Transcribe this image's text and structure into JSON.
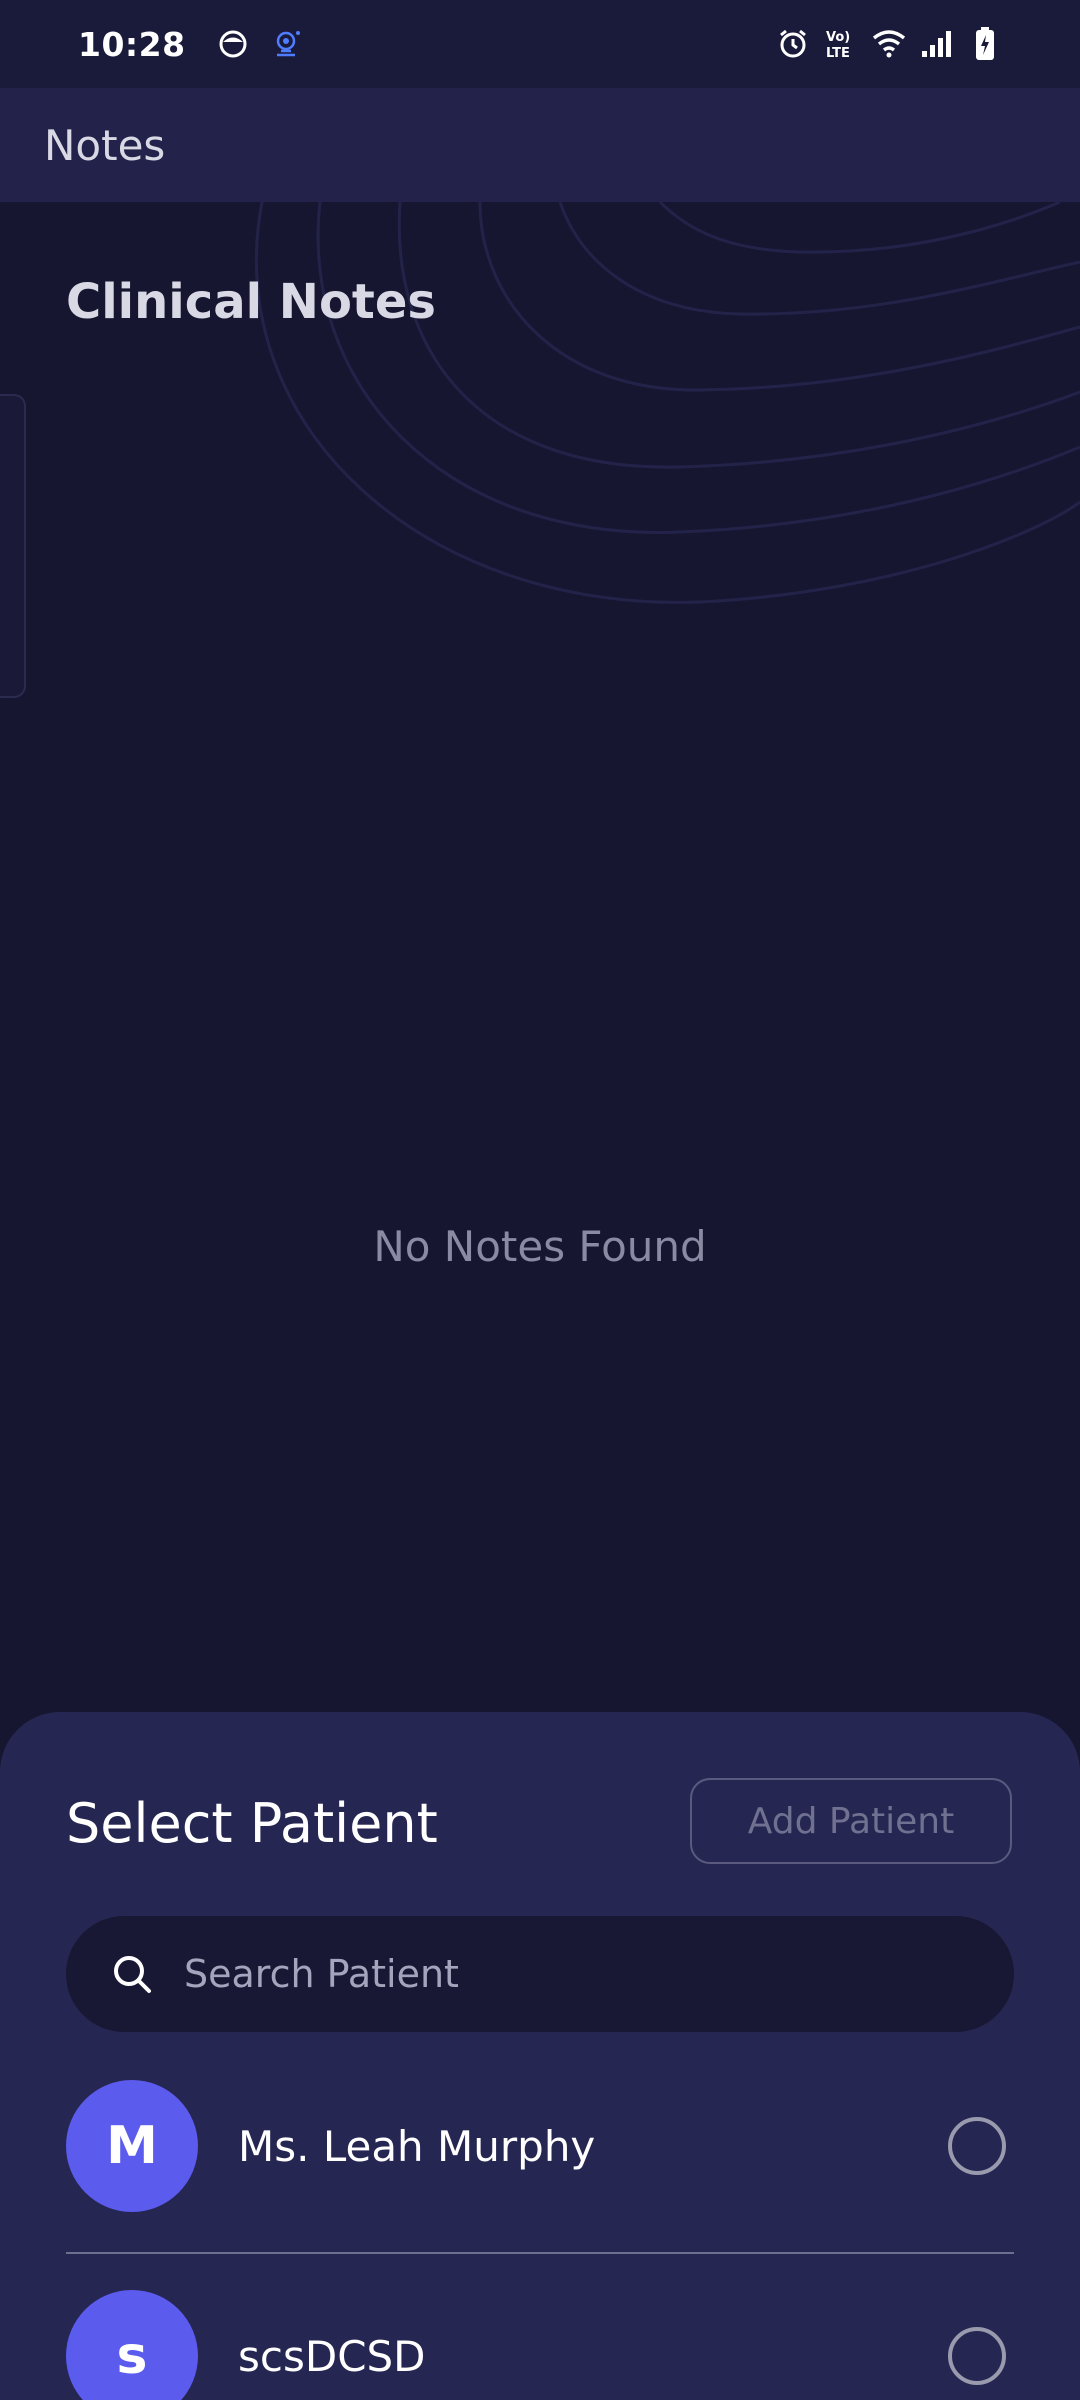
{
  "status_bar": {
    "time": "10:28",
    "left_icons": [
      "app-face-icon",
      "cast-icon"
    ],
    "right_icons": [
      "alarm-icon",
      "volte-icon",
      "wifi-icon",
      "signal-icon",
      "battery-charging-icon"
    ],
    "volte_label_top": "Vo)",
    "volte_label_bottom": "LTE"
  },
  "app_bar": {
    "title": "Notes"
  },
  "main": {
    "section_title": "Clinical Notes",
    "empty_message": "No Notes Found"
  },
  "sheet": {
    "title": "Select Patient",
    "add_button_label": "Add Patient",
    "search_placeholder": "Search Patient",
    "patients": [
      {
        "initial": "M",
        "name": "Ms. Leah Murphy",
        "selected": false
      },
      {
        "initial": "s",
        "name": "scsDCSD",
        "selected": false
      }
    ]
  },
  "colors": {
    "background": "#161631",
    "app_bar": "#22224a",
    "sheet": "#262652",
    "avatar": "#5b5bee",
    "search_field": "#181834"
  }
}
